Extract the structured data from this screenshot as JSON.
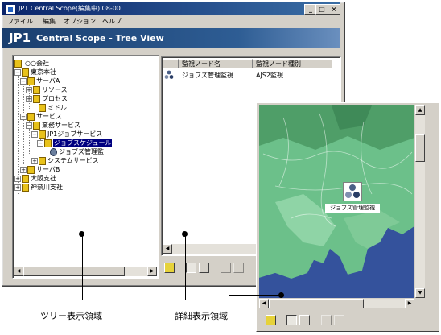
{
  "window": {
    "title": "JP1 Central Scope(編集中) 08-00",
    "controls": {
      "minimize": "_",
      "maximize": "□",
      "close": "×"
    }
  },
  "menu": [
    "ファイル",
    "編集",
    "オプション",
    "ヘルプ"
  ],
  "banner": {
    "logo": "JP1",
    "title": "Central Scope - Tree View"
  },
  "tree": [
    {
      "label": "○○会社"
    },
    {
      "label": "東京本社"
    },
    {
      "label": "サーバA"
    },
    {
      "label": "リソース"
    },
    {
      "label": "プロセス"
    },
    {
      "label": "ミドル"
    },
    {
      "label": "サービス"
    },
    {
      "label": "業務サービス"
    },
    {
      "label": "JP1ジョブサービス"
    },
    {
      "label": "ジョブスケジュール"
    },
    {
      "label": "ジョブズ管理監"
    },
    {
      "label": "システムサービス"
    },
    {
      "label": "サーバB"
    },
    {
      "label": "大阪支社"
    },
    {
      "label": "神奈川支社"
    }
  ],
  "detail": {
    "columns": [
      "監視ノード名",
      "監視ノード種別"
    ],
    "rows": [
      {
        "name": "ジョブズ管理監視",
        "type": "AJS2監視"
      }
    ]
  },
  "map": {
    "node_label": "ジョブズ管理監視"
  },
  "captions": {
    "tree_area": "ツリー表示領域",
    "detail_area": "詳細表示領域"
  },
  "colors": {
    "title_bar": "#0a246a",
    "banner": "#2e5d94",
    "selection": "#000080",
    "map_land": "#6cc08a",
    "map_sea": "#3f5ea8",
    "node_folder": "#e8c21a"
  }
}
